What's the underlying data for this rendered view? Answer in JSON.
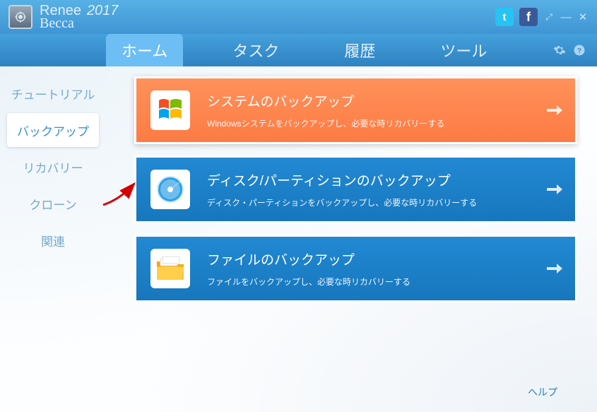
{
  "app": {
    "name1": "Renee",
    "year": "2017",
    "name2": "Becca"
  },
  "window_controls": {
    "pin": "⤢",
    "min": "—",
    "close": "✕"
  },
  "social": {
    "twitter": "t",
    "facebook": "f"
  },
  "tabs": [
    {
      "label": "ホーム",
      "active": true
    },
    {
      "label": "タスク",
      "active": false
    },
    {
      "label": "履歴",
      "active": false
    },
    {
      "label": "ツール",
      "active": false
    }
  ],
  "sidebar": [
    {
      "label": "チュートリアル",
      "active": false
    },
    {
      "label": "バックアップ",
      "active": true
    },
    {
      "label": "リカバリー",
      "active": false
    },
    {
      "label": "クローン",
      "active": false
    },
    {
      "label": "関連",
      "active": false
    }
  ],
  "cards": [
    {
      "title": "システムのバックアップ",
      "desc": "Windowsシステムをバックアップし、必要な時リカバリーする",
      "variant": "orange",
      "icon": "windows"
    },
    {
      "title": "ディスク/パーティションのバックアップ",
      "desc": "ディスク・パーティションをバックアップし、必要な時リカバリーする",
      "variant": "blue",
      "icon": "disk"
    },
    {
      "title": "ファイルのバックアップ",
      "desc": "ファイルをバックアップし、必要な時リカバリーする",
      "variant": "blue",
      "icon": "folder"
    }
  ],
  "footer": {
    "help": "ヘルプ"
  }
}
